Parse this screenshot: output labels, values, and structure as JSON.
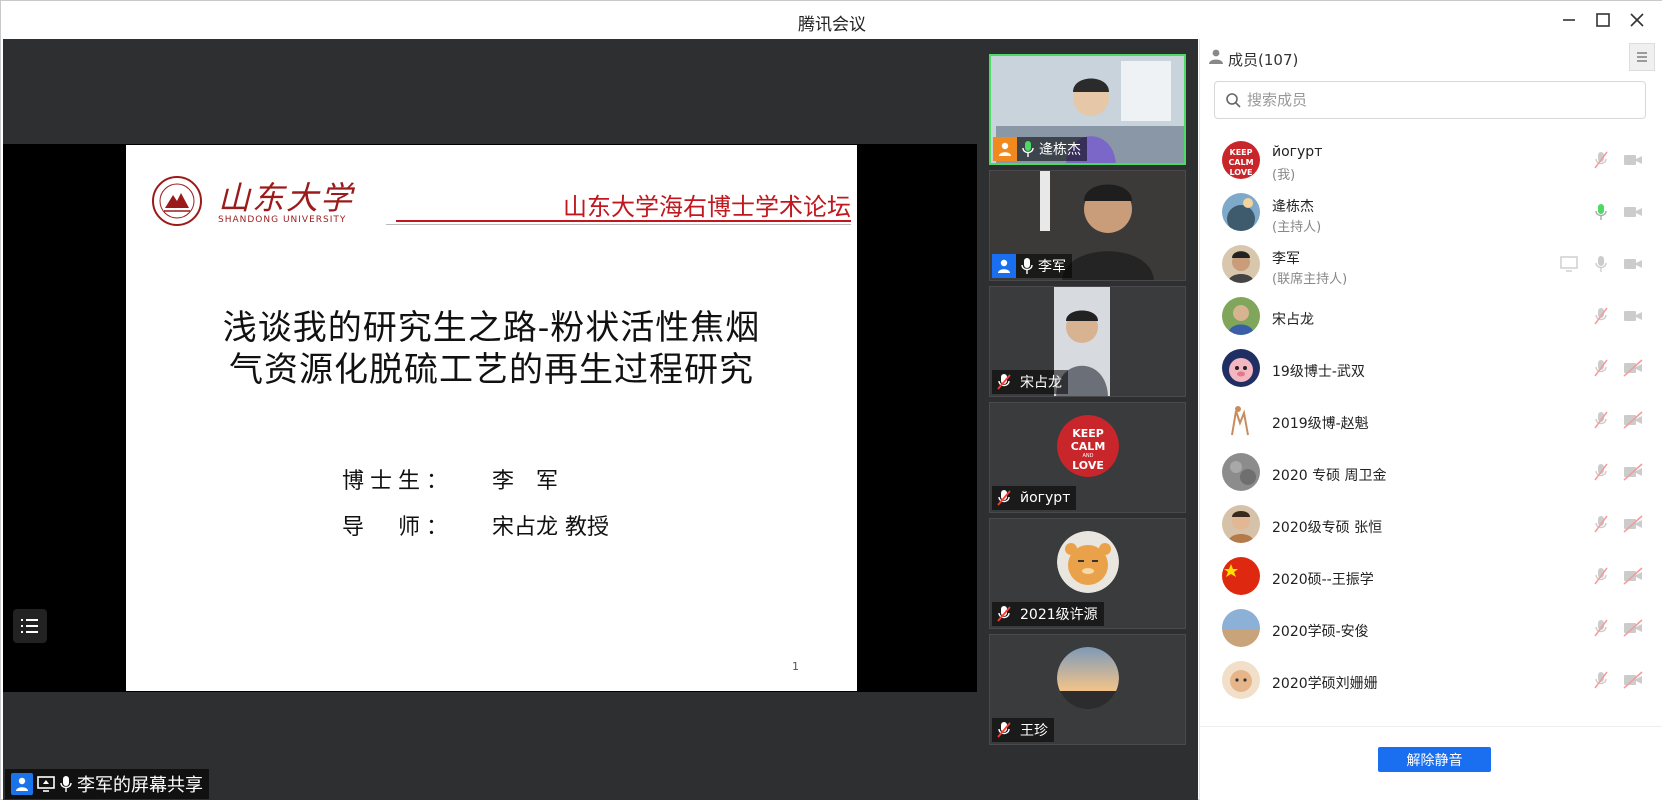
{
  "window": {
    "title": "腾讯会议"
  },
  "slide": {
    "university_cn": "山东大学",
    "university_en": "SHANDONG UNIVERSITY",
    "forum_title": "山东大学海右博士学术论坛",
    "title_line1": "浅谈我的研究生之路-粉状活性焦烟",
    "title_line2": "气资源化脱硫工艺的再生过程研究",
    "phd_label": "博士生：",
    "phd_value": "李　军",
    "advisor_label": "导　师：",
    "advisor_value": "宋占龙 教授",
    "page_number": "1"
  },
  "share_bar": {
    "label": "李军的屏幕共享"
  },
  "videos": [
    {
      "name": "逄栋杰",
      "mic": "on",
      "role": "host"
    },
    {
      "name": "李军",
      "mic": "on",
      "role": "cohost"
    },
    {
      "name": "宋占龙",
      "mic": "muted"
    },
    {
      "name": "йогурт",
      "mic": "muted"
    },
    {
      "name": "2021级许源",
      "mic": "muted"
    },
    {
      "name": "王珍",
      "mic": "muted"
    }
  ],
  "panel": {
    "title": "成员(107)",
    "search_placeholder": "搜索成员",
    "unmute_label": "解除静音",
    "members": [
      {
        "name": "йогурт",
        "sub": "(我)",
        "mic": "muted",
        "cam": "on"
      },
      {
        "name": "逄栋杰",
        "sub": "(主持人)",
        "mic": "active",
        "cam": "on"
      },
      {
        "name": "李军",
        "sub": "(联席主持人)",
        "mic": "on",
        "cam": "on",
        "screen": true
      },
      {
        "name": "宋占龙",
        "sub": "",
        "mic": "muted",
        "cam": "on"
      },
      {
        "name": "19级博士-武双",
        "sub": "",
        "mic": "muted",
        "cam": "off"
      },
      {
        "name": "2019级博-赵魁",
        "sub": "",
        "mic": "muted",
        "cam": "off"
      },
      {
        "name": "2020 专硕 周卫金",
        "sub": "",
        "mic": "muted",
        "cam": "off"
      },
      {
        "name": "2020级专硕 张恒",
        "sub": "",
        "mic": "muted",
        "cam": "off"
      },
      {
        "name": "2020硕--王振学",
        "sub": "",
        "mic": "muted",
        "cam": "off"
      },
      {
        "name": "2020学硕-安俊",
        "sub": "",
        "mic": "muted",
        "cam": "off"
      },
      {
        "name": "2020学硕刘姗姗",
        "sub": "",
        "mic": "muted",
        "cam": "off"
      }
    ]
  },
  "colors": {
    "accent": "#1a6ef0",
    "slide_red": "#c0181e",
    "active_border": "#4cd964",
    "stage_bg": "#2e2f31"
  }
}
